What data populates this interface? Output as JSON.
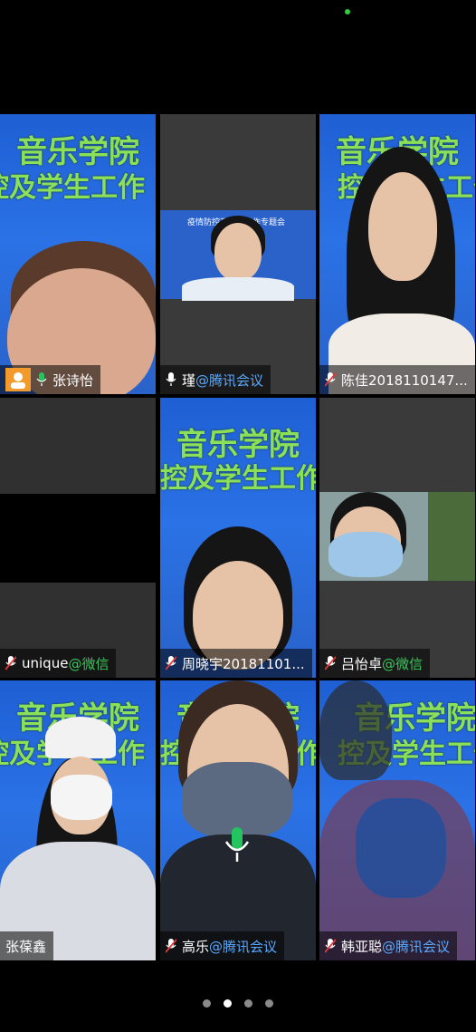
{
  "slide_text": {
    "line1": "音乐学院",
    "line2": "控及学生工作",
    "small": "疫情防控及学生工作专题会"
  },
  "participants": [
    {
      "name": "张诗怡",
      "suffix": "",
      "mic": "on",
      "host": true
    },
    {
      "name": "瑾",
      "suffix": "@腾讯会议",
      "mic": "on",
      "host": false
    },
    {
      "name": "陈佳2018110147...",
      "suffix": "",
      "mic": "off",
      "host": false
    },
    {
      "name": "unique",
      "suffix": "@微信",
      "mic": "off",
      "host": false
    },
    {
      "name": "周晓宇20181101...",
      "suffix": "",
      "mic": "off",
      "host": false
    },
    {
      "name": "吕怡卓",
      "suffix": "@微信",
      "mic": "off",
      "host": false
    },
    {
      "name": "张葆鑫",
      "suffix": "",
      "mic": "none",
      "host": false
    },
    {
      "name": "高乐",
      "suffix": "@腾讯会议",
      "mic": "off",
      "host": false
    },
    {
      "name": "韩亚聪",
      "suffix": "@腾讯会议",
      "mic": "off",
      "host": false
    }
  ],
  "pager": {
    "pages": 4,
    "current": 2
  },
  "colors": {
    "active_border": "#22c55e",
    "suffix_tencent": "#5aa9ff",
    "suffix_wechat": "#38c85a",
    "slide_bg": "#2a72e6"
  }
}
